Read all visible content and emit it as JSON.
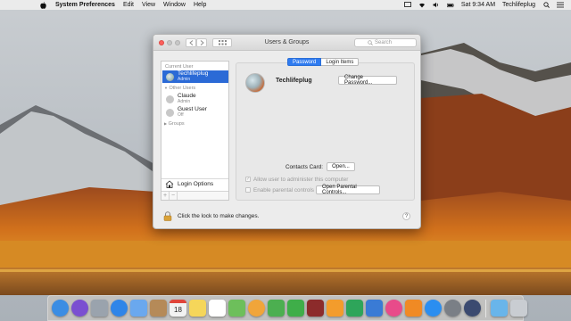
{
  "menubar": {
    "app_name": "System Preferences",
    "menus": [
      "Edit",
      "View",
      "Window",
      "Help"
    ],
    "clock": "Sat 9:34 AM",
    "user": "Techlifeplug"
  },
  "window": {
    "title": "Users & Groups",
    "search_placeholder": "Search"
  },
  "sidebar": {
    "current_user_label": "Current User",
    "other_users_label": "Other Users",
    "groups_label": "Groups",
    "current_user": {
      "name": "Techlifeplug",
      "role": "Admin"
    },
    "other_users": [
      {
        "name": "Claude",
        "role": "Admin"
      },
      {
        "name": "Guest User",
        "role": "Off"
      }
    ],
    "login_options": "Login Options",
    "add": "+",
    "remove": "−"
  },
  "tabs": {
    "password": "Password",
    "login_items": "Login Items"
  },
  "panel": {
    "user_name": "Techlifeplug",
    "change_password": "Change Password...",
    "contacts_card_label": "Contacts Card:",
    "open_button": "Open...",
    "allow_admin": "Allow user to administer this computer",
    "parental_controls": "Enable parental controls",
    "open_parental_button": "Open Parental Controls..."
  },
  "footer": {
    "lock_text": "Click the lock to make changes.",
    "help": "?"
  },
  "dock": {
    "icons": [
      {
        "name": "finder-icon",
        "color": "#3b8de3"
      },
      {
        "name": "siri-icon",
        "color": "#7a4fd1"
      },
      {
        "name": "launchpad-icon",
        "color": "#9aa3ad"
      },
      {
        "name": "safari-icon",
        "color": "#2f85e8"
      },
      {
        "name": "mail-icon",
        "color": "#6aa8ee"
      },
      {
        "name": "contacts-icon",
        "color": "#b58a58"
      },
      {
        "name": "calendar-icon",
        "color": "#f2f2f2"
      },
      {
        "name": "notes-icon",
        "color": "#f5d65a"
      },
      {
        "name": "reminders-icon",
        "color": "#ffffff"
      },
      {
        "name": "maps-icon",
        "color": "#6dbf5b"
      },
      {
        "name": "photos-icon",
        "color": "#f0a53a"
      },
      {
        "name": "messages-icon",
        "color": "#4caf50"
      },
      {
        "name": "facetime-icon",
        "color": "#3fae49"
      },
      {
        "name": "photo-booth-icon",
        "color": "#8c2b2b"
      },
      {
        "name": "pages-icon",
        "color": "#f39c2c"
      },
      {
        "name": "numbers-icon",
        "color": "#2ea55a"
      },
      {
        "name": "keynote-icon",
        "color": "#3a7bd5"
      },
      {
        "name": "itunes-icon",
        "color": "#e84b8a"
      },
      {
        "name": "ibooks-icon",
        "color": "#f08a24"
      },
      {
        "name": "app-store-icon",
        "color": "#2b8ef0"
      },
      {
        "name": "system-preferences-icon",
        "color": "#7a7f86"
      },
      {
        "name": "network-utility-icon",
        "color": "#3b4a70"
      },
      {
        "name": "downloads-folder-icon",
        "color": "#69b5ea"
      },
      {
        "name": "trash-icon",
        "color": "#c9cdd2"
      }
    ],
    "calendar_day": "18"
  }
}
